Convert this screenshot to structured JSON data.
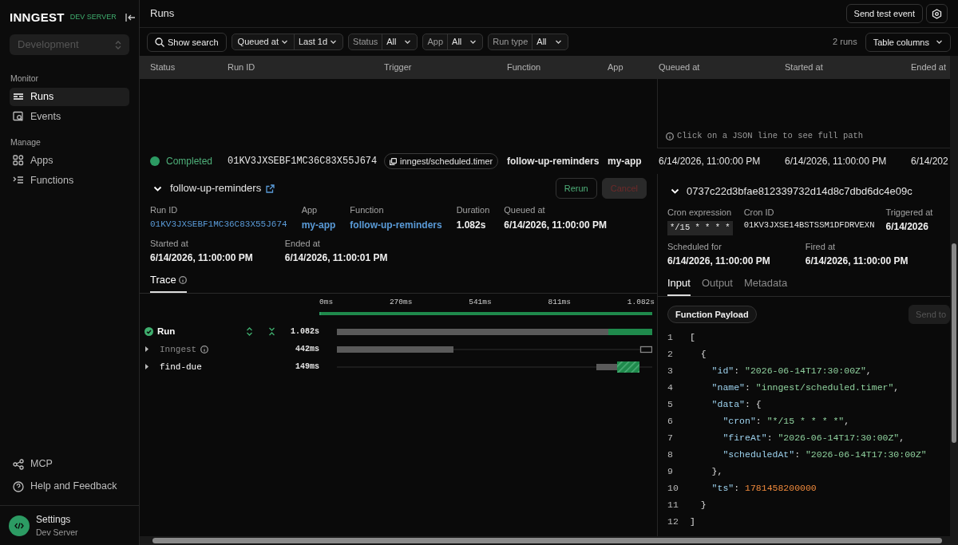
{
  "sidebar": {
    "brand": "INNGEST",
    "badge": "DEV SERVER",
    "env_select": {
      "value": "Development",
      "disabled": true
    },
    "sections": [
      {
        "title": "Monitor",
        "items": [
          {
            "label": "Runs",
            "selected": true
          },
          {
            "label": "Events",
            "selected": false
          }
        ]
      },
      {
        "title": "Manage",
        "items": [
          {
            "label": "Apps",
            "selected": false
          },
          {
            "label": "Functions",
            "selected": false
          }
        ]
      }
    ],
    "footer_links": [
      {
        "label": "MCP"
      },
      {
        "label": "Help and Feedback"
      }
    ],
    "profile": {
      "title": "Settings",
      "subtitle": "Dev Server"
    }
  },
  "header": {
    "title": "Runs",
    "button": "Send test event"
  },
  "toolbar": {
    "search_button": "Show search",
    "filters": [
      {
        "label": "Queued at",
        "value": "Last 1d",
        "kind": "time"
      },
      {
        "label": "Status",
        "value": "All",
        "kind": "select"
      },
      {
        "label": "App",
        "value": "All",
        "kind": "select"
      },
      {
        "label": "Run type",
        "value": "All",
        "kind": "select"
      }
    ],
    "run_count": "2 runs",
    "columns_button": "Table columns"
  },
  "table": {
    "columns": [
      "Status",
      "Run ID",
      "Trigger",
      "Function",
      "App",
      "Queued at",
      "Started at",
      "Ended at"
    ],
    "rows": [
      {
        "status": "Completed",
        "run_id": "01KV3JXSEBF1MC36C83X55J674",
        "trigger": "inngest/scheduled.timer",
        "function": "follow-up-reminders",
        "app": "my-app",
        "queued_at": "6/14/2026, 11:00:00 PM",
        "started_at": "6/14/2026, 11:00:00 PM",
        "ended_at": "6/14/202",
        "expanded": true
      }
    ]
  },
  "run_detail": {
    "title": "follow-up-reminders",
    "actions": [
      {
        "label": "Rerun",
        "disabled": false
      },
      {
        "label": "Cancel",
        "disabled": true
      }
    ],
    "field_rows": [
      [
        {
          "label": "Run ID",
          "value": "01KV3JXSEBF1MC36C83X55J674",
          "kind": "mono-link"
        },
        {
          "label": "App",
          "value": "my-app",
          "kind": "link"
        },
        {
          "label": "Function",
          "value": "follow-up-reminders",
          "kind": "link"
        },
        {
          "label": "Duration",
          "value": "1.082s",
          "kind": "text"
        },
        {
          "label": "Queued at",
          "value": "6/14/2026, 11:00:00 PM",
          "kind": "text"
        }
      ],
      [
        {
          "label": "Started at",
          "value": "6/14/2026, 11:00:00 PM",
          "kind": "text"
        },
        {
          "label": "Ended at",
          "value": "6/14/2026, 11:00:01 PM",
          "kind": "text"
        }
      ]
    ],
    "tabs": [
      {
        "label": "Trace",
        "selected": true
      }
    ]
  },
  "trace": {
    "ticks": [
      "0ms",
      "270ms",
      "541ms",
      "811ms",
      "1.082s"
    ],
    "spans": [
      {
        "name": "Run",
        "kind": "root",
        "duration": "1.082s",
        "children": [
          {
            "name": "Inngest",
            "kind": "system",
            "duration": "442ms",
            "expanded": false
          },
          {
            "name": "find-due",
            "kind": "step",
            "duration": "149ms",
            "expanded": false
          }
        ]
      }
    ]
  },
  "trigger_panel": {
    "hint": "Click on a JSON line to see full path",
    "title": "0737c22d3bfae812339732d14d8c7dbd6dc4e09c",
    "field_rows": [
      [
        {
          "label": "Cron expression",
          "value": "*/15 * * * *",
          "kind": "code"
        },
        {
          "label": "Cron ID",
          "value": "01KV3JXSE14BSTSSM1DFDRVEXN",
          "kind": "mono"
        },
        {
          "label": "Triggered at",
          "value": "6/14/2026",
          "kind": "text"
        }
      ],
      [
        {
          "label": "Scheduled for",
          "value": "6/14/2026, 11:00:00 PM",
          "kind": "text"
        },
        {
          "label": "Fired at",
          "value": "6/14/2026, 11:00:00 PM",
          "kind": "text"
        }
      ]
    ],
    "tabs": [
      {
        "label": "Input",
        "selected": true
      },
      {
        "label": "Output",
        "selected": false
      },
      {
        "label": "Metadata",
        "selected": false
      }
    ],
    "chip": "Function Payload",
    "send_button": {
      "label": "Send to",
      "disabled": true
    },
    "code": [
      {
        "number": "1",
        "tokens": [
          {
            "kind": "punct",
            "text": "["
          }
        ]
      },
      {
        "number": "2",
        "tokens": [
          {
            "kind": "punct",
            "text": "  {"
          }
        ]
      },
      {
        "number": "3",
        "tokens": [
          {
            "kind": "key",
            "text": "    \"id\""
          },
          {
            "kind": "punct",
            "text": ": "
          },
          {
            "kind": "string",
            "text": "\"2026-06-14T17:30:00Z\""
          },
          {
            "kind": "punct",
            "text": ","
          }
        ]
      },
      {
        "number": "4",
        "tokens": [
          {
            "kind": "key",
            "text": "    \"name\""
          },
          {
            "kind": "punct",
            "text": ": "
          },
          {
            "kind": "string",
            "text": "\"inngest/scheduled.timer\""
          },
          {
            "kind": "punct",
            "text": ","
          }
        ]
      },
      {
        "number": "5",
        "tokens": [
          {
            "kind": "key",
            "text": "    \"data\""
          },
          {
            "kind": "punct",
            "text": ": {"
          }
        ]
      },
      {
        "number": "6",
        "tokens": [
          {
            "kind": "key",
            "text": "      \"cron\""
          },
          {
            "kind": "punct",
            "text": ": "
          },
          {
            "kind": "string",
            "text": "\"*/15 * * * *\""
          },
          {
            "kind": "punct",
            "text": ","
          }
        ]
      },
      {
        "number": "7",
        "tokens": [
          {
            "kind": "key",
            "text": "      \"fireAt\""
          },
          {
            "kind": "punct",
            "text": ": "
          },
          {
            "kind": "string",
            "text": "\"2026-06-14T17:30:00Z\""
          },
          {
            "kind": "punct",
            "text": ","
          }
        ]
      },
      {
        "number": "8",
        "tokens": [
          {
            "kind": "key",
            "text": "      \"scheduledAt\""
          },
          {
            "kind": "punct",
            "text": ": "
          },
          {
            "kind": "string",
            "text": "\"2026-06-14T17:30:00Z\""
          }
        ]
      },
      {
        "number": "9",
        "tokens": [
          {
            "kind": "punct",
            "text": "    },"
          }
        ]
      },
      {
        "number": "10",
        "tokens": [
          {
            "kind": "key",
            "text": "    \"ts\""
          },
          {
            "kind": "punct",
            "text": ": "
          },
          {
            "kind": "number",
            "text": "1781458200000"
          }
        ]
      },
      {
        "number": "11",
        "tokens": [
          {
            "kind": "punct",
            "text": "  }"
          }
        ]
      },
      {
        "number": "12",
        "tokens": [
          {
            "kind": "punct",
            "text": "]"
          }
        ]
      }
    ]
  }
}
